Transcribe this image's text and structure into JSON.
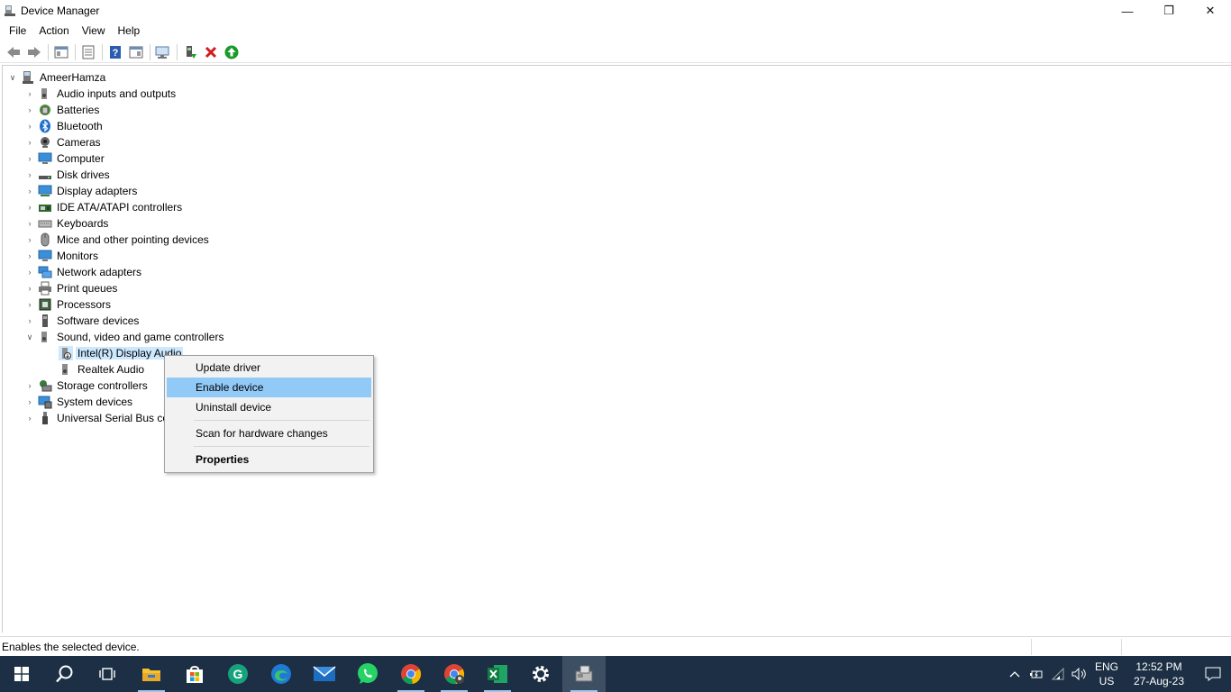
{
  "window": {
    "title": "Device Manager",
    "controls": {
      "minimize": "—",
      "restore": "❐",
      "close": "✕"
    }
  },
  "menu": [
    "File",
    "Action",
    "View",
    "Help"
  ],
  "toolbar": {
    "icons": [
      "back-arrow-icon",
      "forward-arrow-icon",
      "show-hide-console-tree-icon",
      "properties-icon",
      "help-icon",
      "action-pane-icon",
      "scan-hardware-icon",
      "update-driver-icon",
      "uninstall-icon",
      "enable-device-icon"
    ]
  },
  "tree": {
    "root": "AmeerHamza",
    "categories": [
      "Audio inputs and outputs",
      "Batteries",
      "Bluetooth",
      "Cameras",
      "Computer",
      "Disk drives",
      "Display adapters",
      "IDE ATA/ATAPI controllers",
      "Keyboards",
      "Mice and other pointing devices",
      "Monitors",
      "Network adapters",
      "Print queues",
      "Processors",
      "Software devices",
      "Sound, video and game controllers"
    ],
    "sound_children": [
      "Intel(R) Display Audio",
      "Realtek Audio"
    ],
    "after_categories": [
      "Storage controllers",
      "System devices",
      "Universal Serial Bus co"
    ]
  },
  "context_menu": {
    "update": "Update driver",
    "enable": "Enable device",
    "uninstall": "Uninstall device",
    "scan": "Scan for hardware changes",
    "properties": "Properties"
  },
  "status": {
    "text": "Enables the selected device."
  },
  "taskbar": {
    "apps": [
      "windows-start-icon",
      "search-icon",
      "task-view-icon",
      "file-explorer-icon",
      "microsoft-store-icon",
      "grammarly-icon",
      "edge-icon",
      "mail-icon",
      "whatsapp-icon",
      "chrome-icon",
      "chrome-profile-icon",
      "excel-icon",
      "settings-icon",
      "device-manager-icon"
    ],
    "lang_top": "ENG",
    "lang_bottom": "US",
    "time": "12:52 PM",
    "date": "27-Aug-23"
  },
  "colors": {
    "taskbar": "#1c2f44",
    "menu_highlight": "#91c9f7",
    "selection": "#cce8ff"
  }
}
